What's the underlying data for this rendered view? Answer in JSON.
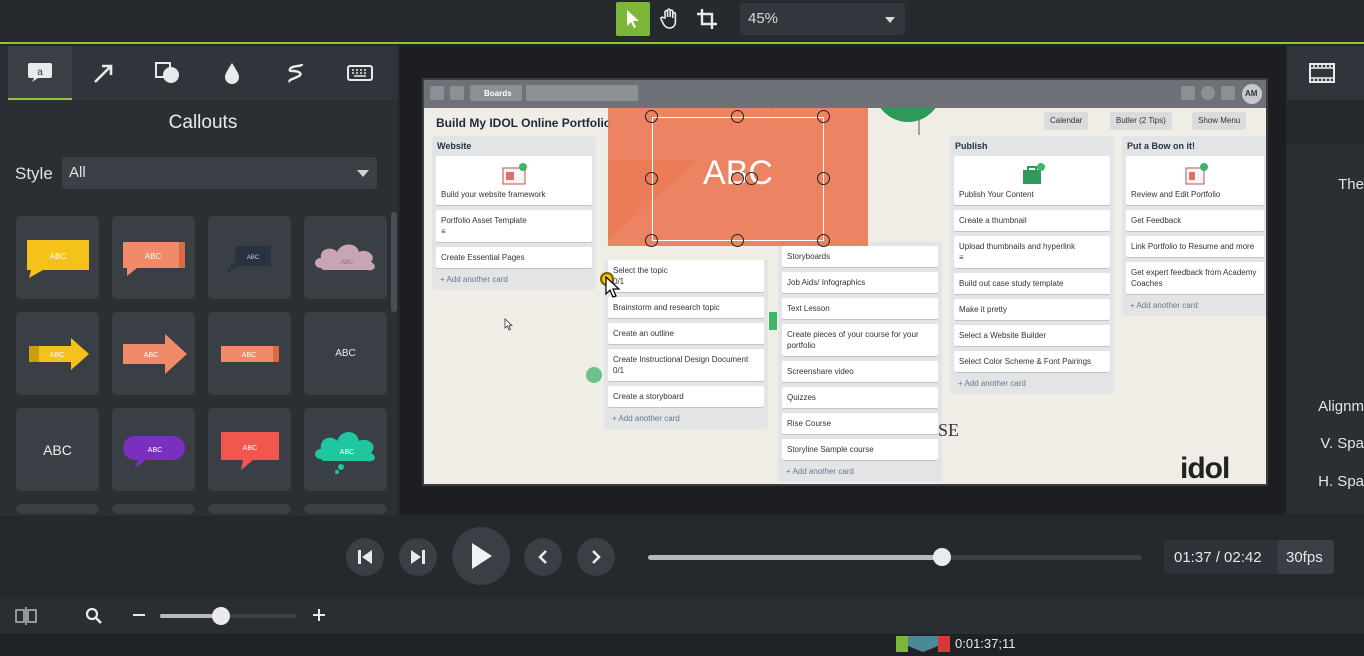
{
  "toolbar": {
    "zoom_value": "45%",
    "tools": [
      {
        "name": "select-arrow-icon",
        "active": true
      },
      {
        "name": "hand-pan-icon",
        "active": false
      },
      {
        "name": "crop-icon",
        "active": false
      }
    ]
  },
  "left_panel": {
    "title": "Callouts",
    "style_label": "Style",
    "style_value": "All",
    "tiles": [
      {
        "name": "yellow-speech-callout",
        "label": "ABC"
      },
      {
        "name": "orange-box-callout",
        "label": "ABC"
      },
      {
        "name": "dark-thought-callout",
        "label": "ABC"
      },
      {
        "name": "pink-cloud-callout",
        "label": "ABC"
      },
      {
        "name": "yellow-arrow-callout",
        "label": "ABC"
      },
      {
        "name": "orange-arrow-callout",
        "label": "ABC"
      },
      {
        "name": "orange-banner-callout",
        "label": "ABC"
      },
      {
        "name": "plain-text-callout",
        "label": "ABC"
      },
      {
        "name": "large-text-callout",
        "label": "ABC"
      },
      {
        "name": "purple-bubble-callout",
        "label": "ABC"
      },
      {
        "name": "red-speech-callout",
        "label": "ABC"
      },
      {
        "name": "teal-cloud-callout",
        "label": "ABC"
      }
    ]
  },
  "video": {
    "trello_nav": "Boards",
    "avatar": "AM",
    "board_title": "Build My IDOL Online Portfolio",
    "header_buttons": [
      "Calendar",
      "Butler (2 Tips)",
      "Show Menu"
    ],
    "lists": [
      {
        "title": "Website",
        "cards": [
          "Build your website framework",
          "Portfolio Asset Template",
          "Create Essential Pages"
        ],
        "add": "+ Add another card"
      },
      {
        "title": "",
        "cards": [
          "Select the topic",
          "Brainstorm and research topic",
          "Create an outline",
          "Create Instructional Design Document",
          "Create a storyboard"
        ],
        "badges": [
          "0/1",
          "0/1"
        ],
        "add": "+ Add another card"
      },
      {
        "title": "",
        "cards": [
          "Storyboards",
          "Job Aids/ Infographics",
          "Text Lesson",
          "Create pieces of your course for your portfolio",
          "Screenshare video",
          "Quizzes",
          "Rise Course",
          "Storyline Sample course"
        ],
        "add": "+ Add another card"
      },
      {
        "title": "Publish",
        "cards": [
          "Publish Your Content",
          "Create a thumbnail",
          "Upload thumbnails and hyperlink",
          "Build out case study template",
          "Make it pretty",
          "Select a Website Builder",
          "Select Color Scheme & Font Pairings"
        ],
        "add": "+ Add another card"
      },
      {
        "title": "Put a Bow on it!",
        "cards": [
          "Review and Edit Portfolio",
          "Get Feedback",
          "Link Portfolio to Resume and more",
          "Get expert feedback from Academy Coaches"
        ],
        "add": "+ Add another card"
      }
    ],
    "callout_text": "ABC",
    "logo": "idol",
    "bg_fragment": "SE"
  },
  "right_panel": {
    "labels": [
      "The",
      "Alignm",
      "V. Spa",
      "H. Spa"
    ]
  },
  "transport": {
    "time": "01:37 / 02:42",
    "fps": "30fps",
    "progress": 0.595
  },
  "timeline": {
    "playhead_time": "0:01:37;11",
    "zoom_level": 0.45
  },
  "colors": {
    "accent": "#8cc63f",
    "callout": "#ec7b57"
  }
}
